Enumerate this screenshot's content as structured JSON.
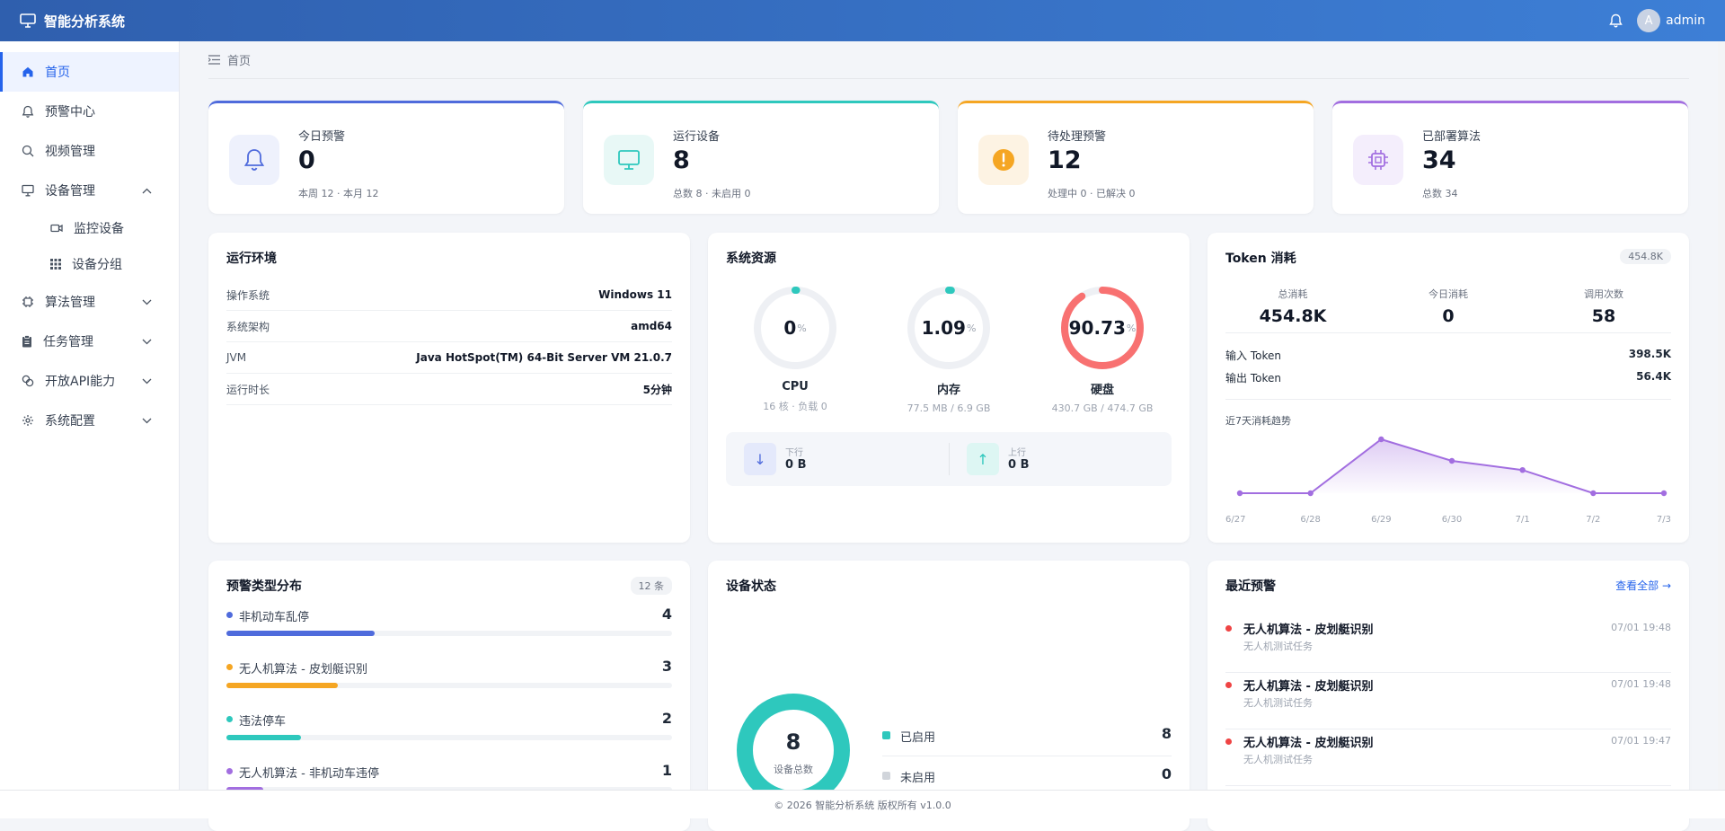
{
  "app": {
    "title": "智能分析系统",
    "user": "admin",
    "avatar_letter": "A"
  },
  "sidebar": {
    "items": [
      {
        "label": "首页"
      },
      {
        "label": "预警中心"
      },
      {
        "label": "视频管理"
      },
      {
        "label": "设备管理"
      },
      {
        "label": "监控设备"
      },
      {
        "label": "设备分组"
      },
      {
        "label": "算法管理"
      },
      {
        "label": "任务管理"
      },
      {
        "label": "开放API能力"
      },
      {
        "label": "系统配置"
      }
    ]
  },
  "breadcrumb": {
    "label": "首页"
  },
  "stats": [
    {
      "label": "今日预警",
      "value": "0",
      "sub": "本周 12 · 本月 12",
      "color": "#4f6bdc"
    },
    {
      "label": "运行设备",
      "value": "8",
      "sub": "总数 8 · 未启用 0",
      "color": "#2ec8bd"
    },
    {
      "label": "待处理预警",
      "value": "12",
      "sub": "处理中 0 · 已解决 0",
      "color": "#f5a623"
    },
    {
      "label": "已部署算法",
      "value": "34",
      "sub": "总数 34",
      "color": "#a26ee0"
    }
  ],
  "env": {
    "title": "运行环境",
    "rows": [
      {
        "k": "操作系统",
        "v": "Windows 11"
      },
      {
        "k": "系统架构",
        "v": "amd64"
      },
      {
        "k": "JVM",
        "v": "Java HotSpot(TM) 64-Bit Server VM 21.0.7"
      },
      {
        "k": "运行时长",
        "v": "5分钟"
      }
    ]
  },
  "resources": {
    "title": "系统资源",
    "gauges": [
      {
        "value": "0",
        "percent": 0,
        "unit": "%",
        "name": "CPU",
        "sub": "16 核 · 负载 0",
        "color": "#2ec8bd"
      },
      {
        "value": "1.09",
        "percent": 1.09,
        "unit": "%",
        "name": "内存",
        "sub": "77.5 MB / 6.9 GB",
        "color": "#2ec8bd"
      },
      {
        "value": "90.73",
        "percent": 90.73,
        "unit": "%",
        "name": "硬盘",
        "sub": "430.7 GB / 474.7 GB",
        "color": "#f87171"
      }
    ],
    "net": {
      "down_label": "下行",
      "down_value": "0 B",
      "up_label": "上行",
      "up_value": "0 B"
    }
  },
  "token": {
    "title": "Token 消耗",
    "badge": "454.8K",
    "total_label": "总消耗",
    "total": "454.8K",
    "today_label": "今日消耗",
    "today": "0",
    "calls_label": "调用次数",
    "calls": "58",
    "input_label": "输入 Token",
    "input": "398.5K",
    "output_label": "输出 Token",
    "output": "56.4K",
    "trend_title": "近7天消耗趋势"
  },
  "chart_data": {
    "type": "area",
    "title": "近7天消耗趋势",
    "categories": [
      "6/27",
      "6/28",
      "6/29",
      "6/30",
      "7/1",
      "7/2",
      "7/3"
    ],
    "values": [
      0,
      0,
      100,
      60,
      43,
      0,
      0
    ],
    "color": "#a26ee0"
  },
  "alert_types": {
    "title": "预警类型分布",
    "badge": "12 条",
    "items": [
      {
        "name": "非机动车乱停",
        "count": "4",
        "ratio": 0.333,
        "color": "#4f6bdc"
      },
      {
        "name": "无人机算法 - 皮划艇识别",
        "count": "3",
        "ratio": 0.25,
        "color": "#f5a623"
      },
      {
        "name": "违法停车",
        "count": "2",
        "ratio": 0.167,
        "color": "#2ec8bd"
      },
      {
        "name": "无人机算法 - 非机动车违停",
        "count": "1",
        "ratio": 0.083,
        "color": "#a26ee0"
      }
    ]
  },
  "device_status": {
    "title": "设备状态",
    "total": "8",
    "total_label": "设备总数",
    "legend": [
      {
        "label": "已启用",
        "value": "8",
        "color": "#2ec8bd"
      },
      {
        "label": "未启用",
        "value": "0",
        "color": "#d1d5db"
      }
    ]
  },
  "recent": {
    "title": "最近预警",
    "link": "查看全部 →",
    "items": [
      {
        "title": "无人机算法 - 皮划艇识别",
        "sub": "无人机测试任务",
        "time": "07/01 19:48"
      },
      {
        "title": "无人机算法 - 皮划艇识别",
        "sub": "无人机测试任务",
        "time": "07/01 19:48"
      },
      {
        "title": "无人机算法 - 皮划艇识别",
        "sub": "无人机测试任务",
        "time": "07/01 19:47"
      }
    ]
  },
  "footer": "© 2026 智能分析系统 版权所有 v1.0.0"
}
